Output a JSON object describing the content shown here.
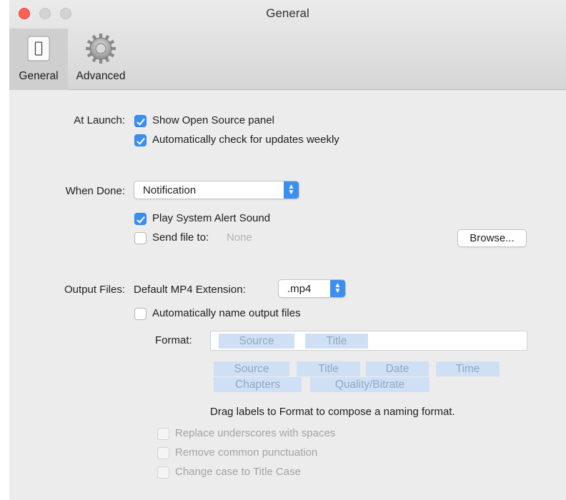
{
  "window": {
    "title": "General"
  },
  "toolbar": {
    "tabs": [
      {
        "label": "General",
        "icon": "switch-icon",
        "selected": true
      },
      {
        "label": "Advanced",
        "icon": "gear-icon",
        "selected": false
      }
    ]
  },
  "at_launch": {
    "label": "At Launch:",
    "show_open_source": {
      "label": "Show Open Source panel",
      "checked": true
    },
    "check_updates": {
      "label": "Automatically check for updates weekly",
      "checked": true
    }
  },
  "when_done": {
    "label": "When Done:",
    "selected": "Notification",
    "play_alert": {
      "label": "Play System Alert Sound",
      "checked": true
    },
    "send_file": {
      "label": "Send file to:",
      "value": "None",
      "checked": false
    },
    "browse_label": "Browse..."
  },
  "output_files": {
    "label": "Output Files:",
    "ext_label": "Default MP4 Extension:",
    "ext_value": ".mp4",
    "auto_name": {
      "label": "Automatically name output files",
      "checked": false
    },
    "format_label": "Format:",
    "format_tokens": [
      "Source",
      "Title"
    ],
    "available_tokens": [
      "Source",
      "Title",
      "Date",
      "Time",
      "Chapters",
      "Quality/Bitrate"
    ],
    "hint": "Drag labels to Format to compose a naming format.",
    "options": [
      {
        "label": "Replace underscores with spaces",
        "checked": false,
        "enabled": false
      },
      {
        "label": "Remove common punctuation",
        "checked": false,
        "enabled": false
      },
      {
        "label": "Change case to Title Case",
        "checked": false,
        "enabled": false
      }
    ]
  },
  "colors": {
    "accent": "#3c8ff0",
    "close": "#fc5f57",
    "token_bg": "#cfe0f5",
    "token_text": "#8ea8c6"
  }
}
